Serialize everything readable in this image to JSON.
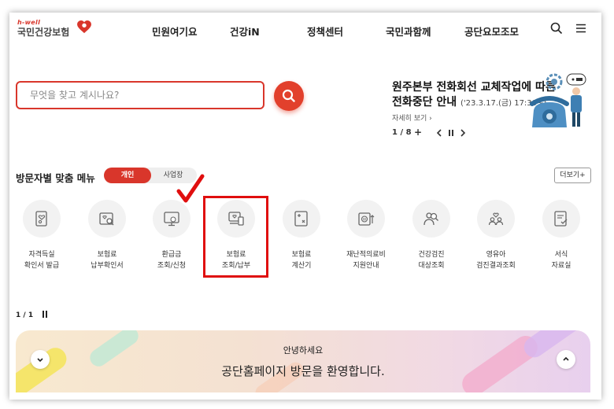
{
  "header": {
    "logo_sub": "h-well",
    "logo_main": "국민건강보험",
    "nav": [
      "민원여기요",
      "건강iN",
      "정책센터",
      "국민과함께",
      "공단요모조모"
    ]
  },
  "search": {
    "placeholder": "무엇을 찾고 계시나요?"
  },
  "notice": {
    "title_line1": "원주본부 전화회선 교체작업에 따른",
    "title_line2": "전화중단 안내",
    "date": "('23.3.17.(금) 17:30~)",
    "more": "자세히 보기 ›",
    "pager": "1 / 8",
    "plus": "+"
  },
  "menu": {
    "title": "방문자별 맞춤 메뉴",
    "tabs": [
      "개인",
      "사업장"
    ],
    "more": "더보기+",
    "items": [
      {
        "label": "자격득실\n확인서 발급",
        "icon": "certificate-icon"
      },
      {
        "label": "보험료\n납부확인서",
        "icon": "search-document-icon"
      },
      {
        "label": "환급금\n조회/신청",
        "icon": "monitor-refund-icon"
      },
      {
        "label": "보험료\n조회/납부",
        "icon": "computer-payment-icon"
      },
      {
        "label": "보험료\n계산기",
        "icon": "calculator-icon"
      },
      {
        "label": "재난적의료비\n지원안내",
        "icon": "medical-fund-icon"
      },
      {
        "label": "건강검진\n대상조회",
        "icon": "people-search-icon"
      },
      {
        "label": "영유아\n검진결과조회",
        "icon": "family-icon"
      },
      {
        "label": "서식\n자료실",
        "icon": "form-document-icon"
      }
    ],
    "page_indicator": "1 / 1"
  },
  "banner": {
    "greeting": "안녕하세요",
    "message": "공단홈페이지 방문을 환영합니다."
  },
  "colors": {
    "brand": "#d9362b",
    "highlight": "#e00e0e"
  }
}
